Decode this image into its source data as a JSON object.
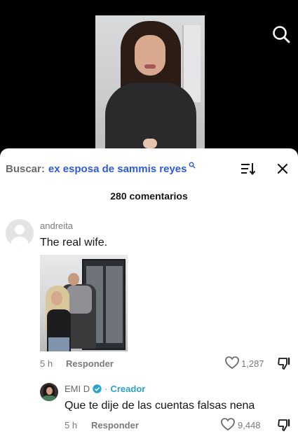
{
  "video": {
    "thumbnail": "video-frame-woman"
  },
  "header": {
    "search_icon": "search-icon"
  },
  "sheet": {
    "search_prefix": "Buscar:",
    "search_query": "ex esposa de sammis reyes",
    "comment_count": "280 comentarios",
    "sort_icon": "sort-icon",
    "close_icon": "close-icon"
  },
  "comments": [
    {
      "username": "andreita",
      "text": "The real wife.",
      "has_image": true,
      "time": "5 h",
      "reply_label": "Responder",
      "likes": "1,287"
    },
    {
      "username": "EMI D",
      "verified": true,
      "separator": "·",
      "badge": "Creador",
      "text": "Que te dije de las cuentas falsas nena",
      "time": "5 h",
      "reply_label": "Responder",
      "likes": "9,448"
    }
  ],
  "colors": {
    "accent_blue": "#2d5bd7",
    "creator_teal": "#2aa4c9",
    "muted_text": "#7a7a7a"
  }
}
